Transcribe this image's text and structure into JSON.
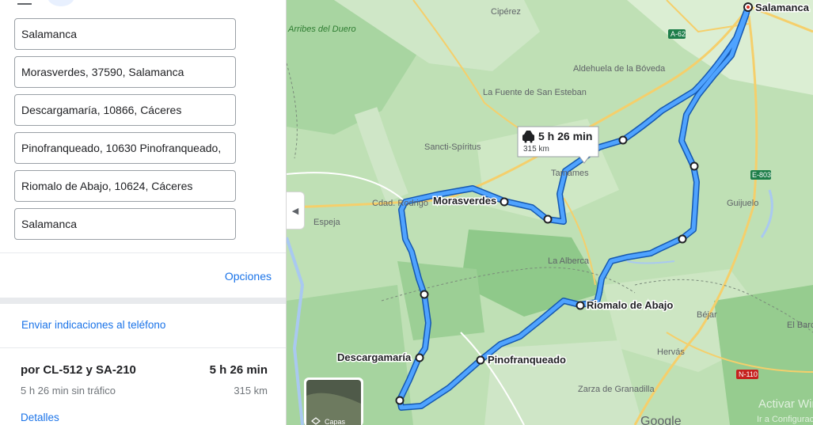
{
  "stops": [
    "Salamanca",
    "Morasverdes, 37590, Salamanca",
    "Descargamaría, 10866, Cáceres",
    "Pinofranqueado, 10630 Pinofranqueado,",
    "Riomalo de Abajo, 10624, Cáceres",
    "Salamanca"
  ],
  "options_label": "Opciones",
  "send_label": "Enviar indicaciones al teléfono",
  "route": {
    "via": "por CL-512 y SA-210",
    "time": "5 h 26 min",
    "no_traffic": "5 h 26 min sin tráfico",
    "distance": "315 km",
    "details_label": "Detalles"
  },
  "callout": {
    "time": "5 h 26 min",
    "distance": "315 km"
  },
  "map": {
    "route_color": "#1a73e8",
    "place_labels": [
      "Cipérez",
      "Aldehuela de la Bóveda",
      "La Fuente de San Esteban",
      "Sancti-Spíritus",
      "Tamames",
      "Espeja",
      "Cdad. Rodrigo",
      "La Alberca",
      "Guijuelo",
      "Béjar",
      "Hervás",
      "Zarza de Granadilla",
      "El Barco de Ávila"
    ],
    "natural_area": "Arribes del Duero",
    "road_shields": [
      "A-62",
      "E-803",
      "N-110"
    ],
    "waypoint_labels": [
      "Salamanca",
      "Morasverdes",
      "Riomalo de Abajo",
      "Descargamaría",
      "Pinofranqueado"
    ],
    "layer_label": "Capas",
    "watermark": "Activar Windows",
    "watermark_sub": "Ir a Configuración",
    "google": "Google"
  }
}
